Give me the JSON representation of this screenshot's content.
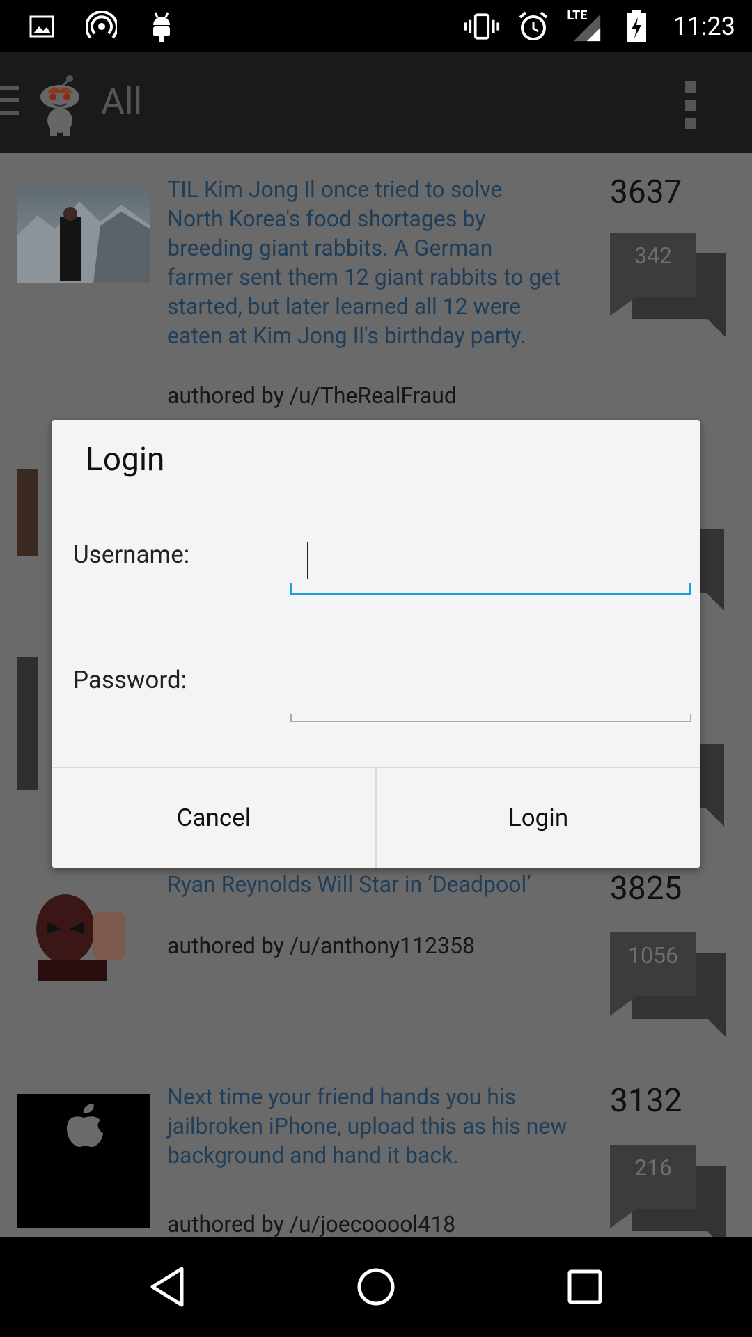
{
  "status_bar": {
    "time": "11:23",
    "left_icons": [
      "image-icon",
      "hotspot-icon",
      "android-icon"
    ],
    "right_icons": [
      "vibrate-icon",
      "alarm-icon",
      "lte-signal-icon",
      "battery-charging-icon"
    ],
    "network_label": "LTE"
  },
  "action_bar": {
    "title": "All"
  },
  "posts": [
    {
      "title": "TIL Kim Jong Il once tried to solve North Korea's food shortages by breeding giant rabbits. A German farmer sent them 12 giant rabbits to get started, but later learned all 12 were eaten at Kim Jong Il's birthday party.",
      "author": "authored by /u/TheRealFraud",
      "score": "3637",
      "comments": "342"
    },
    {
      "title": "Ryan Reynolds Will Star in ‘Deadpool’",
      "author": "authored by /u/anthony112358",
      "score": "3825",
      "comments": "1056"
    },
    {
      "title": "Next time your friend hands you his jailbroken iPhone, upload this as his new background and hand it back.",
      "author": "authored by /u/joecooool418",
      "score": "3132",
      "comments": "216"
    }
  ],
  "dialog": {
    "title": "Login",
    "username_label": "Username:",
    "username_value": "",
    "password_label": "Password:",
    "password_value": "",
    "cancel_label": "Cancel",
    "login_label": "Login"
  },
  "colors": {
    "accent": "#1aa0d8",
    "link": "#1f3e59",
    "dialog_bg": "#f4f4f4"
  }
}
